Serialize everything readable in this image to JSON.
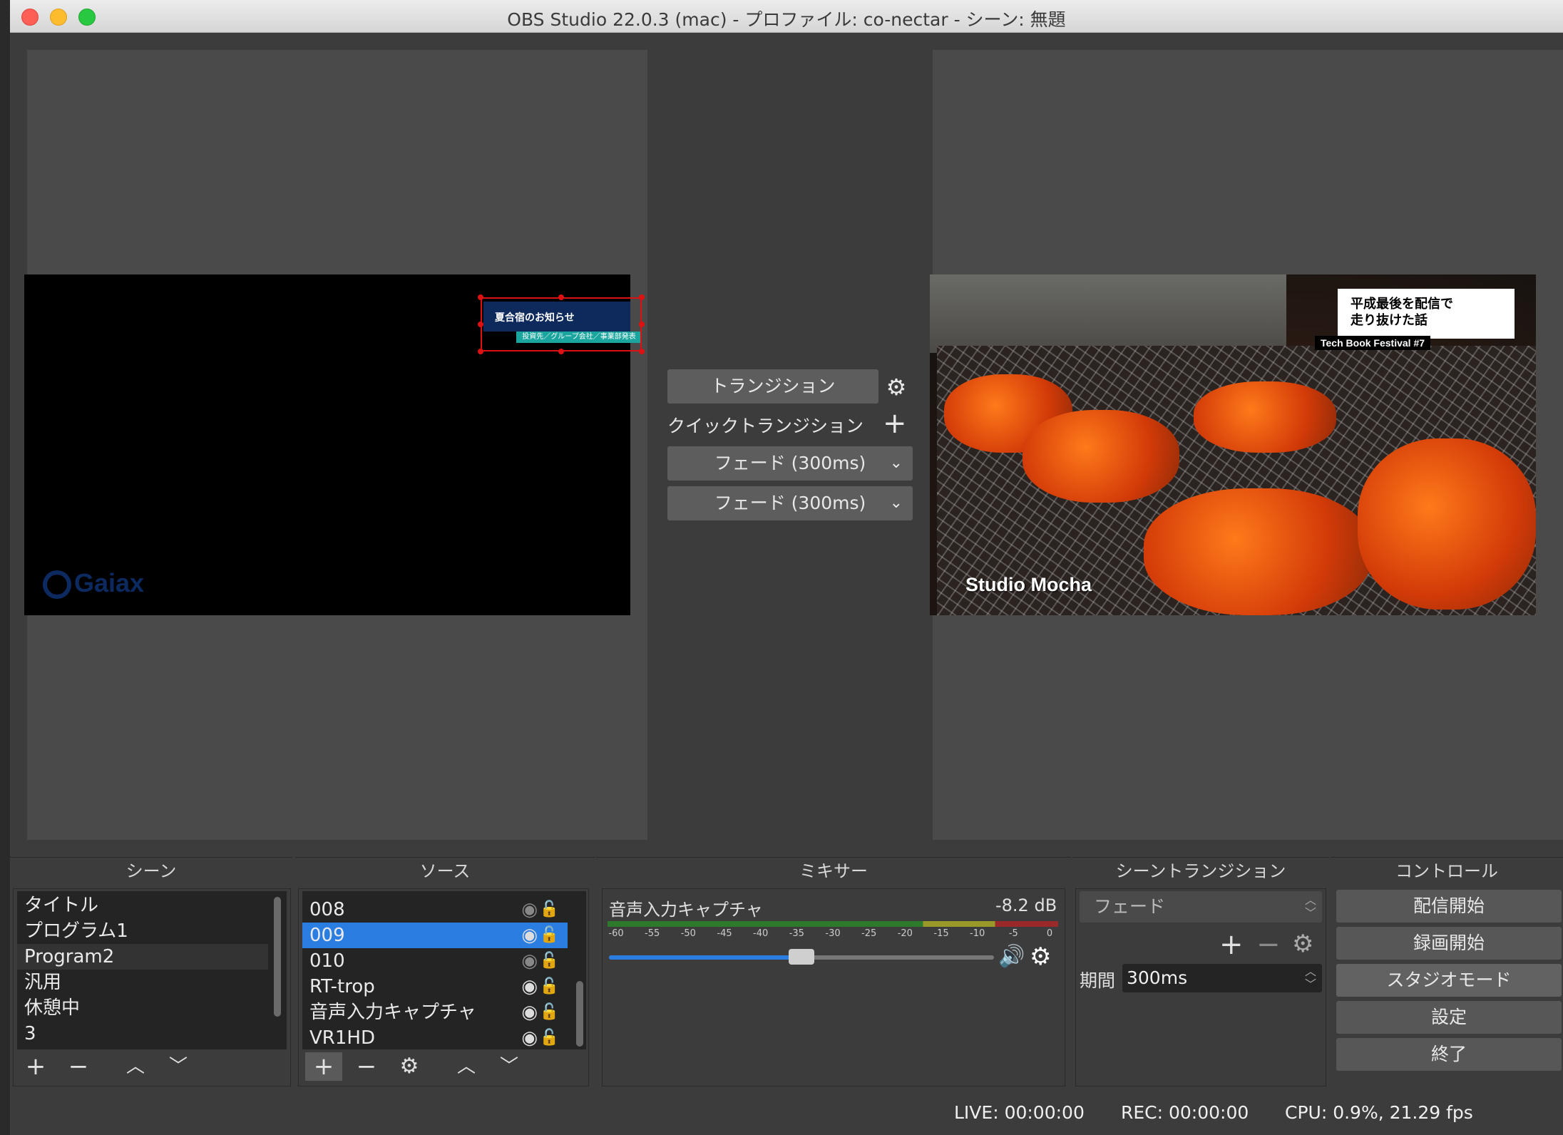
{
  "window": {
    "title": "OBS Studio 22.0.3 (mac) - プロファイル: co-nectar - シーン: 無題"
  },
  "preview": {
    "notice_title": "夏合宿のお知らせ",
    "notice_sub": "投資先／グループ会社／事業部発表",
    "logo_text": "Gaiax"
  },
  "program": {
    "caption": "平成最後を配信で\n走り抜けた話",
    "tag": "Tech Book Festival #7",
    "studio": "Studio Mocha"
  },
  "transition_panel": {
    "transition_label": "トランジション",
    "quick_label": "クイックトランジション",
    "fade_1": "フェード (300ms)",
    "fade_2": "フェード (300ms)"
  },
  "docks": {
    "scenes": "シーン",
    "sources": "ソース",
    "mixer": "ミキサー",
    "scene_transitions": "シーントランジション",
    "controls": "コントロール"
  },
  "scenes": [
    "タイトル",
    "プログラム1",
    "Program2",
    "汎用",
    "休憩中",
    "3"
  ],
  "sources": [
    "008",
    "009",
    "010",
    "RT-trop",
    "音声入力キャプチャ",
    "VR1HD"
  ],
  "mixer": {
    "name": "音声入力キャプチャ",
    "db": "-8.2 dB",
    "ticks": [
      "-60",
      "-55",
      "-50",
      "-45",
      "-40",
      "-35",
      "-30",
      "-25",
      "-20",
      "-15",
      "-10",
      "-5",
      "0"
    ],
    "volume_fraction": 0.5
  },
  "scene_transition": {
    "selected": "フェード",
    "period_label": "期間",
    "period_value": "300ms"
  },
  "controls": {
    "start_stream": "配信開始",
    "start_record": "録画開始",
    "studio_mode": "スタジオモード",
    "settings": "設定",
    "exit": "終了"
  },
  "status": {
    "live": "LIVE: 00:00:00",
    "rec": "REC: 00:00:00",
    "cpu": "CPU: 0.9%, 21.29 fps"
  }
}
